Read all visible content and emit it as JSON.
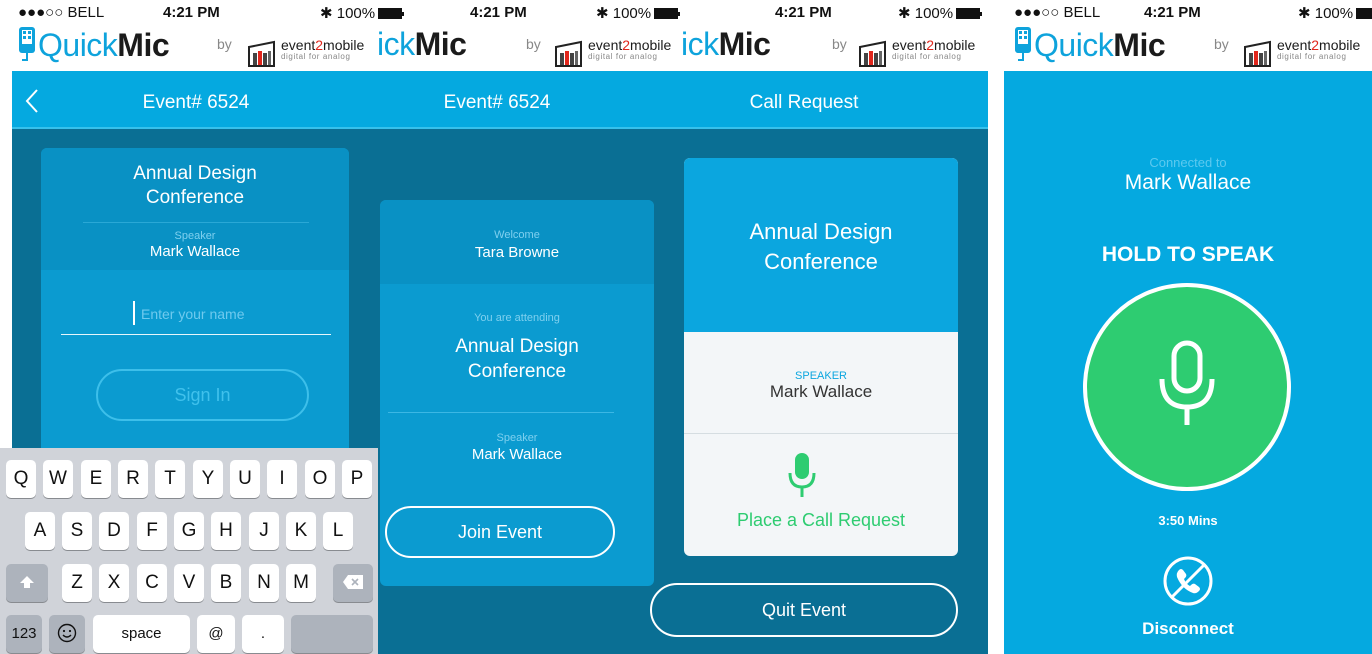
{
  "status_bar": {
    "carrier": "●●●○○ BELL",
    "time": "4:21 PM",
    "battery": "100%"
  },
  "brand": {
    "app_name_light": "Quick",
    "app_name_bold": "Mic",
    "by": "by",
    "partner_a": "event",
    "partner_two": "2",
    "partner_b": "mobile",
    "partner_tagline": "digital for analog"
  },
  "colors": {
    "primary": "#05a9e0",
    "dark": "#0a6f94",
    "green": "#2ecc71"
  },
  "screen1": {
    "title": "Event# 6524",
    "event_name_line1": "Annual Design",
    "event_name_line2": "Conference",
    "speaker_label": "Speaker",
    "speaker_name": "Mark Wallace",
    "name_placeholder": "Enter your name",
    "sign_in": "Sign In"
  },
  "keyboard": {
    "row1": [
      "Q",
      "W",
      "E",
      "R",
      "T",
      "Y",
      "U",
      "I",
      "O",
      "P"
    ],
    "row2": [
      "A",
      "S",
      "D",
      "F",
      "G",
      "H",
      "J",
      "K",
      "L"
    ],
    "row3": [
      "Z",
      "X",
      "C",
      "V",
      "B",
      "N",
      "M"
    ],
    "numbers": "123",
    "space": "space",
    "at": "@",
    "dot": "."
  },
  "screen2": {
    "title": "Event# 6524",
    "welcome_label": "Welcome",
    "user_name": "Tara Browne",
    "attending_label": "You are attending",
    "event_name_line1": "Annual Design",
    "event_name_line2": "Conference",
    "speaker_label": "Speaker",
    "speaker_name": "Mark Wallace",
    "join": "Join Event"
  },
  "screen3": {
    "title": "Call Request",
    "event_name_line1": "Annual Design",
    "event_name_line2": "Conference",
    "speaker_label": "SPEAKER",
    "speaker_name": "Mark Wallace",
    "place_call": "Place a Call Request",
    "quit": "Quit Event"
  },
  "screen4": {
    "connected_label": "Connected to",
    "connected_name": "Mark Wallace",
    "hold_to_speak": "HOLD TO SPEAK",
    "duration": "3:50 Mins",
    "disconnect": "Disconnect"
  }
}
